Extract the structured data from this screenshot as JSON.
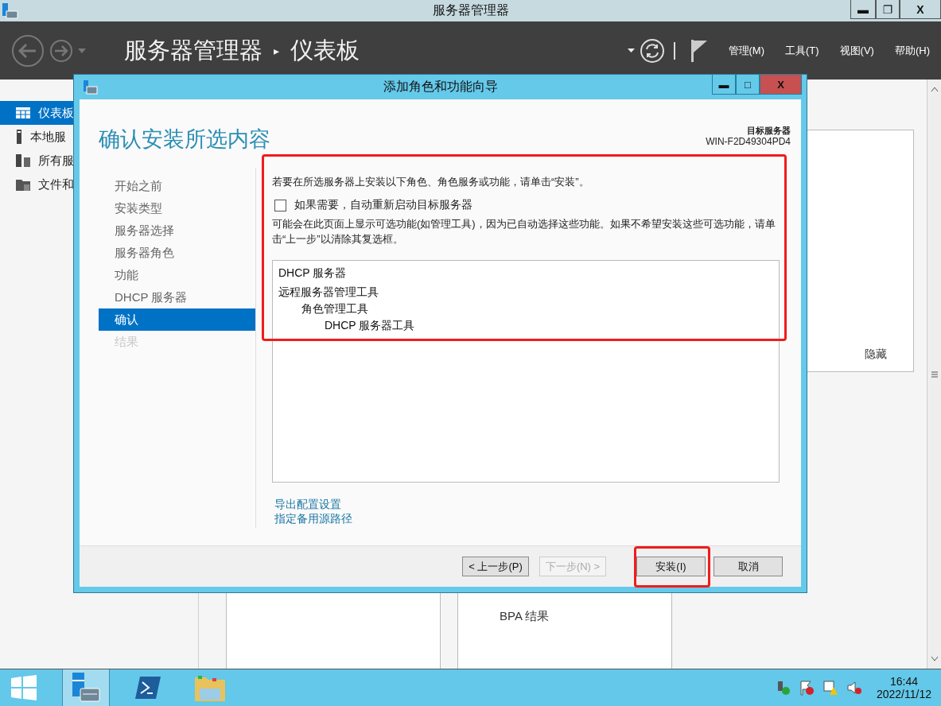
{
  "window": {
    "title": "服务器管理器",
    "controls": [
      "▬",
      "❐",
      "X"
    ]
  },
  "header": {
    "breadcrumb": [
      "服务器管理器",
      "仪表板"
    ],
    "separator": "▸",
    "menus": [
      "管理(M)",
      "工具(T)",
      "视图(V)",
      "帮助(H)"
    ]
  },
  "sidebar": {
    "items": [
      {
        "label": "仪表板",
        "selected": true
      },
      {
        "label": "本地服",
        "selected": false
      },
      {
        "label": "所有服",
        "selected": false
      },
      {
        "label": "文件和",
        "selected": false
      }
    ]
  },
  "main": {
    "hide_link": "隐藏",
    "cards": [
      {
        "label": "BPA 结果"
      }
    ]
  },
  "dialog": {
    "title": "添加角色和功能向导",
    "controls": [
      "▬",
      "□",
      "X"
    ],
    "heading": "确认安装所选内容",
    "target_label": "目标服务器",
    "target_server": "WIN-F2D49304PD4",
    "steps": [
      {
        "label": "开始之前",
        "selected": false,
        "disabled": false
      },
      {
        "label": "安装类型",
        "selected": false,
        "disabled": false
      },
      {
        "label": "服务器选择",
        "selected": false,
        "disabled": false
      },
      {
        "label": "服务器角色",
        "selected": false,
        "disabled": false
      },
      {
        "label": "功能",
        "selected": false,
        "disabled": false
      },
      {
        "label": "DHCP 服务器",
        "selected": false,
        "disabled": false
      },
      {
        "label": "确认",
        "selected": true,
        "disabled": false
      },
      {
        "label": "结果",
        "selected": false,
        "disabled": true
      }
    ],
    "intro": "若要在所选服务器上安装以下角色、角色服务或功能，请单击“安装”。",
    "restart_option": {
      "label": "如果需要，自动重新启动目标服务器",
      "checked": false
    },
    "note": "可能会在此页面上显示可选功能(如管理工具)，因为已自动选择这些功能。如果不希望安装这些可选功能，请单击“上一步”以清除其复选框。",
    "items": [
      {
        "label": "DHCP 服务器"
      },
      {
        "label": "远程服务器管理工具",
        "children": [
          {
            "label": "角色管理工具",
            "children": [
              {
                "label": "DHCP 服务器工具"
              }
            ]
          }
        ]
      }
    ],
    "links": [
      "导出配置设置",
      "指定备用源路径"
    ],
    "buttons": [
      {
        "label": "< 上一步(P)",
        "disabled": false,
        "kind": "nav"
      },
      {
        "label": "下一步(N) >",
        "disabled": true,
        "kind": "nav"
      },
      {
        "label": "安装(I)",
        "disabled": false,
        "kind": "action"
      },
      {
        "label": "取消",
        "disabled": false,
        "kind": "action"
      }
    ]
  },
  "annotations": [
    {
      "kind": "frame"
    },
    {
      "kind": "frame"
    }
  ],
  "taskbar": {
    "apps": [
      {
        "selected": false
      },
      {
        "selected": true
      },
      {
        "selected": false
      },
      {
        "selected": false
      }
    ],
    "time": "16:44",
    "date": "2022/11/12"
  }
}
